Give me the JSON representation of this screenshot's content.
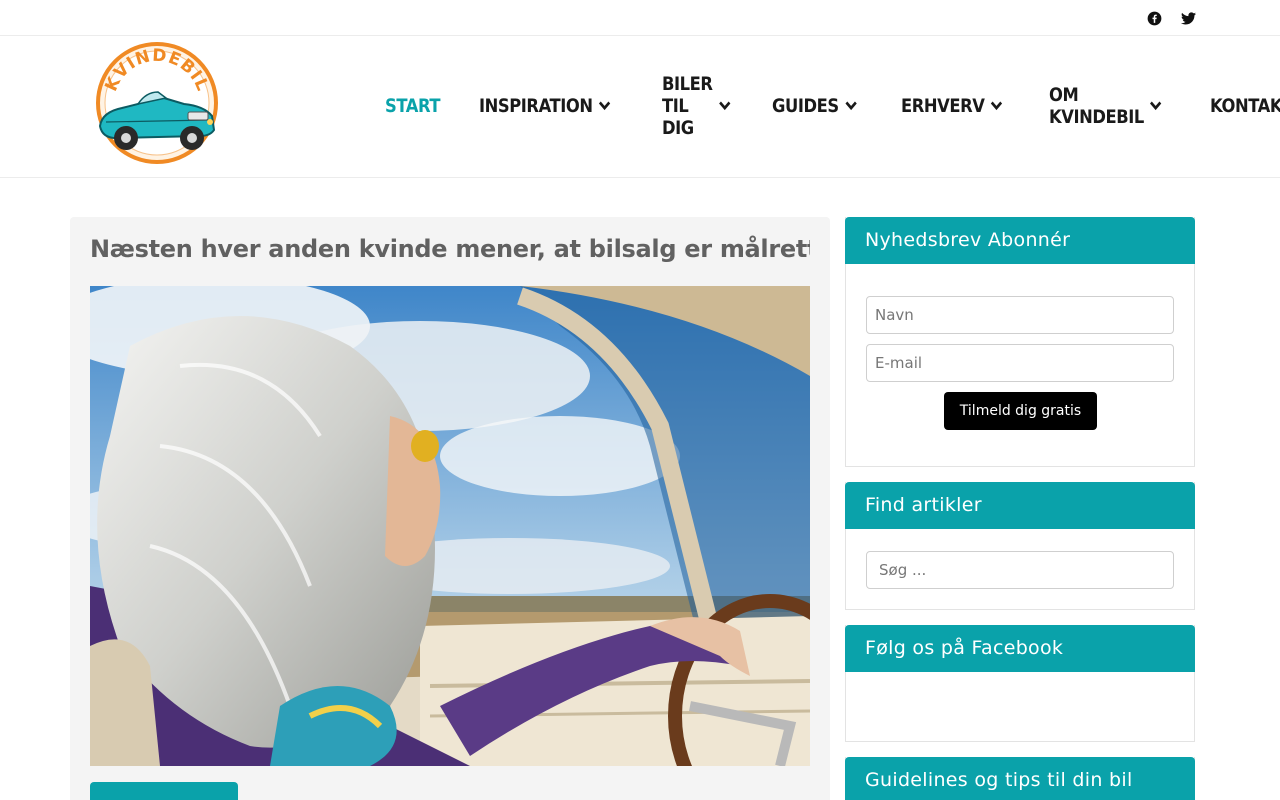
{
  "topbar": {
    "social": [
      {
        "icon": "facebook-icon"
      },
      {
        "icon": "twitter-icon"
      }
    ]
  },
  "header": {
    "logo_text": "KVINDEBIL",
    "nav": [
      {
        "label": "START",
        "dropdown": false,
        "active": true
      },
      {
        "label": "INSPIRATION",
        "dropdown": true,
        "active": false
      },
      {
        "label": "BILER TIL DIG",
        "dropdown": true,
        "active": false
      },
      {
        "label": "GUIDES",
        "dropdown": true,
        "active": false
      },
      {
        "label": "ERHVERV",
        "dropdown": true,
        "active": false
      },
      {
        "label": "OM KVINDEBIL",
        "dropdown": true,
        "active": false
      },
      {
        "label": "KONTAKT",
        "dropdown": false,
        "active": false
      }
    ]
  },
  "post": {
    "title": "Næsten hver anden kvinde mener, at bilsalg er målrettet mænd"
  },
  "sidebar": {
    "newsletter": {
      "title": "Nyhedsbrev Abonnér",
      "name_placeholder": "Navn",
      "email_placeholder": "E-mail",
      "button": "Tilmeld dig gratis"
    },
    "search": {
      "title": "Find artikler",
      "placeholder": "Søg ..."
    },
    "facebook": {
      "title": "Følg os på Facebook"
    },
    "guides": {
      "title": "Guidelines og tips til din bil"
    }
  },
  "colors": {
    "accent": "#0aa2aa",
    "nav_text": "#1a1a1a",
    "title_text": "#616161",
    "logo_orange": "#f08a24"
  }
}
